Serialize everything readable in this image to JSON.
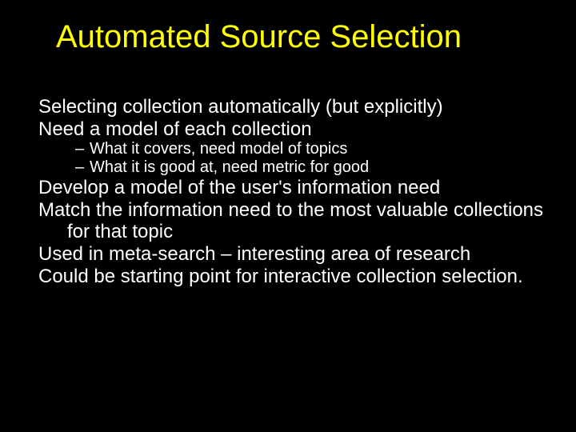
{
  "title": "Automated Source Selection",
  "lines": {
    "l1": "Selecting collection automatically (but explicitly)",
    "l2": "Need a model of each collection",
    "l2a": "What it covers, need model of topics",
    "l2b": "What it is good at, need metric for good",
    "l3": "Develop a model of the user's information need",
    "l4": "Match the information need to the most valuable collections for that topic",
    "l5": "Used in meta-search – interesting area of research",
    "l6": "Could be starting point for interactive collection selection."
  }
}
